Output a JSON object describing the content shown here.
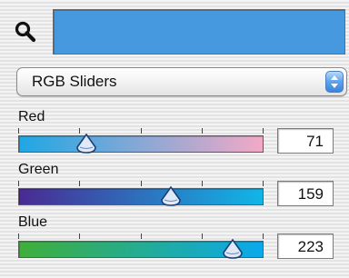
{
  "search": {
    "icon": "magnifier-icon"
  },
  "swatch": {
    "color": "#4799df"
  },
  "mode_popup": {
    "selected": "RGB Sliders",
    "icon": "up-down-arrows-icon"
  },
  "sliders": [
    {
      "label": "Red",
      "value": "71",
      "level": 0.278,
      "gradient": [
        "#1ea7e4",
        "#f2a9c6"
      ]
    },
    {
      "label": "Green",
      "value": "159",
      "level": 0.624,
      "gradient": [
        "#4a2a92",
        "#10b6e8"
      ]
    },
    {
      "label": "Blue",
      "value": "223",
      "level": 0.875,
      "gradient": [
        "#3fae3a",
        "#0aa9ec"
      ]
    }
  ]
}
